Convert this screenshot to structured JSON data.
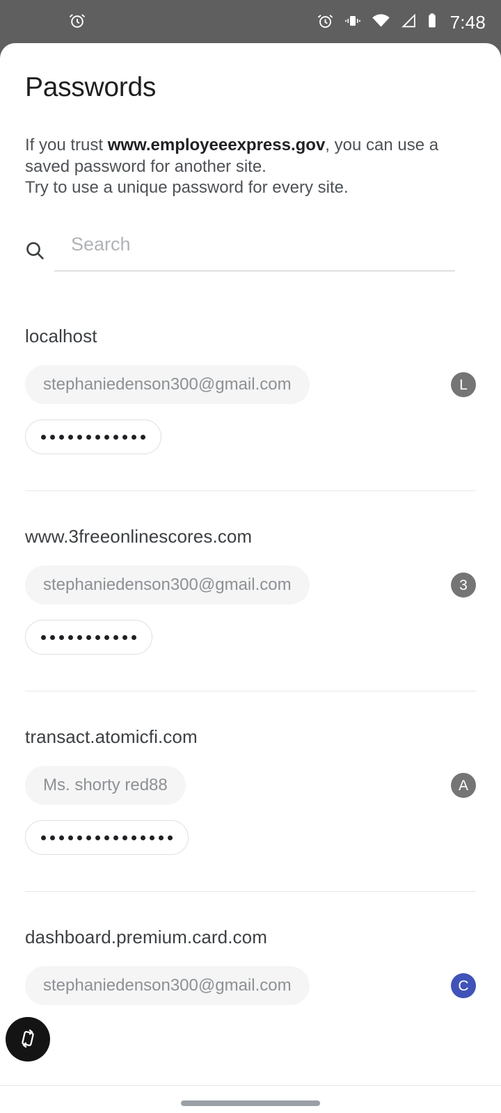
{
  "status_bar": {
    "left_icons": [
      {
        "name": "alarm-icon",
        "glyph": "alarm"
      }
    ],
    "right_icons": [
      {
        "name": "alarm-icon",
        "glyph": "alarm"
      },
      {
        "name": "vibrate-icon",
        "glyph": "vibrate"
      },
      {
        "name": "wifi-icon",
        "glyph": "wifi"
      },
      {
        "name": "cell-signal-icon",
        "glyph": "signal"
      },
      {
        "name": "battery-icon",
        "glyph": "battery"
      }
    ],
    "time": "7:48",
    "background": "#5f5f5f"
  },
  "header": {
    "title": "Passwords"
  },
  "blurb": {
    "line1_prefix": "If you trust ",
    "domain": "www.employeeexpress.gov",
    "line1_suffix": ", you can use a saved password for another site.",
    "line2": "Try to use a unique password for every site."
  },
  "search": {
    "icon": "search-icon",
    "value": "",
    "placeholder": "Search"
  },
  "entries": [
    {
      "site": "localhost",
      "username": "stephaniedenson300@gmail.com",
      "avatar_letter": "L",
      "avatar_color": "#757575",
      "password_dots": 12,
      "show_password_row": true,
      "show_divider": true
    },
    {
      "site": "www.3freeonlinescores.com",
      "username": "stephaniedenson300@gmail.com",
      "avatar_letter": "3",
      "avatar_color": "#757575",
      "password_dots": 11,
      "show_password_row": true,
      "show_divider": true
    },
    {
      "site": "transact.atomicfi.com",
      "username": "Ms. shorty red88",
      "avatar_letter": "A",
      "avatar_color": "#757575",
      "password_dots": 15,
      "show_password_row": true,
      "show_divider": true
    },
    {
      "site": "dashboard.premium.card.com",
      "username": "stephaniedenson300@gmail.com",
      "avatar_letter": "C",
      "avatar_color": "#4053b8",
      "password_dots": 0,
      "show_password_row": false,
      "show_divider": false
    }
  ],
  "fab": {
    "icon": "screen-rotation-icon",
    "color": "#141414"
  },
  "nav_bar": {
    "gesture_handle": "home-gesture-pill"
  },
  "colors": {
    "accent_blue": "#4053b8",
    "avatar_gray": "#757575",
    "chip_bg": "#f5f5f6",
    "divider": "#e6e7e8"
  }
}
